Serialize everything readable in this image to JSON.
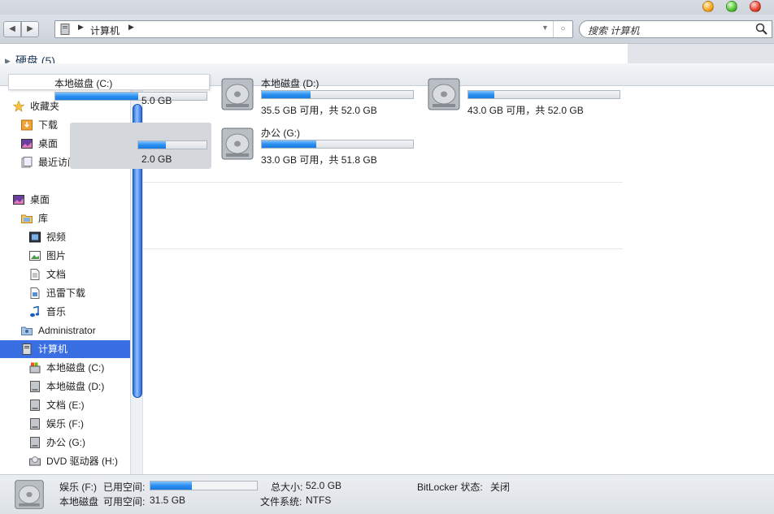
{
  "address": {
    "breadcrumb": "计算机",
    "search_placeholder": "搜索 计算机"
  },
  "group_header": "硬盘 (5)",
  "tooltip": "本地磁盘 (C:)",
  "sidebar": {
    "favorites": "收藏夹",
    "downloads": "下载",
    "desktop_fav": "桌面",
    "recent": "最近访问的位置",
    "desktop": "桌面",
    "libraries": "库",
    "videos": "视频",
    "pictures": "图片",
    "documents": "文档",
    "thunder": "迅雷下载",
    "music": "音乐",
    "admin": "Administrator",
    "computer": "计算机",
    "drive_c": "本地磁盘 (C:)",
    "drive_d": "本地磁盘 (D:)",
    "drive_e": "文档 (E:)",
    "drive_f": "娱乐 (F:)",
    "drive_g": "办公 (G:)",
    "drive_h": "DVD 驱动器 (H:)"
  },
  "drives": {
    "c": {
      "name": "",
      "size": "5.0 GB",
      "used_fraction": 0.55
    },
    "d": {
      "name": "本地磁盘 (D:)",
      "size": "35.5 GB 可用，共 52.0 GB",
      "used_fraction": 0.32
    },
    "e": {
      "name": "",
      "size": "43.0 GB 可用，共 52.0 GB",
      "used_fraction": 0.17
    },
    "f": {
      "name": "",
      "size": "2.0 GB",
      "used_fraction": 0.4
    },
    "g": {
      "name": "办公 (G:)",
      "size": "33.0 GB 可用，共 51.8 GB",
      "used_fraction": 0.36
    }
  },
  "status": {
    "drive_name": "娱乐 (F:)",
    "used_label": "已用空间:",
    "drive_type": "本地磁盘",
    "free_label": "可用空间:",
    "free_value": "31.5 GB",
    "total_label": "总大小:",
    "total_value": "52.0 GB",
    "fs_label": "文件系统:",
    "fs_value": "NTFS",
    "bitlocker_label": "BitLocker 状态:",
    "bitlocker_value": "关闭",
    "used_fraction": 0.39
  }
}
